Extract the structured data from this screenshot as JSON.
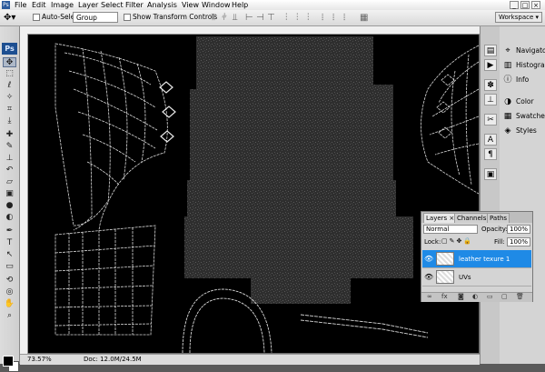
{
  "menu": [
    "File",
    "Edit",
    "Image",
    "Layer",
    "Select",
    "Filter",
    "Analysis",
    "View",
    "Window",
    "Help"
  ],
  "window_controls": [
    "_",
    "□",
    "×"
  ],
  "options_bar": {
    "auto_select_label": "Auto-Select:",
    "auto_select_value": "Group",
    "show_transform_label": "Show Transform Controls",
    "workspace_label": "Workspace ▾"
  },
  "toolbox": {
    "logo": "Ps"
  },
  "right_panels": [
    "Navigator",
    "Histogram",
    "Info",
    "Color",
    "Swatches",
    "Styles"
  ],
  "layers_panel": {
    "tabs": [
      "Layers ×",
      "Channels",
      "Paths"
    ],
    "blend_mode": "Normal",
    "opacity_label": "Opacity:",
    "opacity_value": "100%",
    "lock_label": "Lock:",
    "fill_label": "Fill:",
    "fill_value": "100%",
    "layers": [
      {
        "name": "leather texure 1",
        "selected": true
      },
      {
        "name": "UVs",
        "selected": false
      }
    ]
  },
  "status": {
    "zoom": "73.57%",
    "doc": "Doc: 12.0M/24.5M"
  },
  "colors": {
    "canvas": "#000000",
    "selection": "#1f8ae6",
    "wireframe": "#dcdcdc",
    "texture": "#3a3a3a"
  }
}
